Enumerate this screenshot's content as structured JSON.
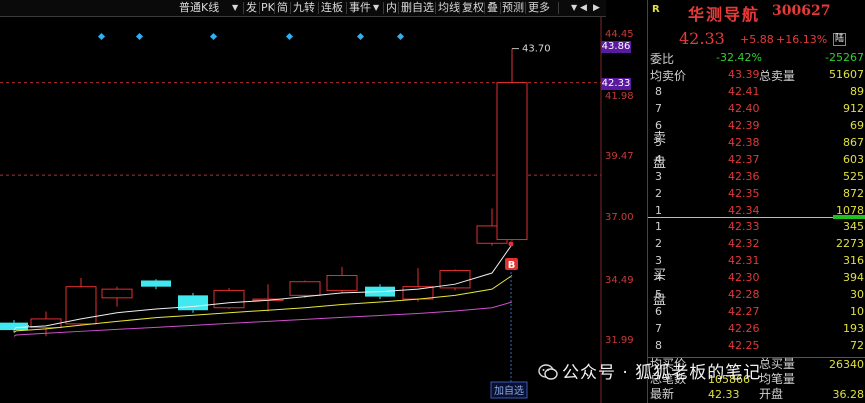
{
  "toolbar": {
    "items": [
      "普通K线",
      "发",
      "PK",
      "简",
      "九转",
      "连板",
      "事件",
      "内",
      "删自选",
      "均线",
      "复权",
      "叠",
      "预测",
      "更多"
    ],
    "dropdown": "▼",
    "back": "◀",
    "forward": "▶"
  },
  "chart": {
    "axis_labels": [
      "44.45",
      "41.98",
      "39.47",
      "37.00",
      "34.49",
      "31.99"
    ],
    "price_tags": [
      "43.86",
      "42.33"
    ],
    "high_label": "43.70",
    "buy_marker": "B",
    "add_button": "加自选"
  },
  "chart_data": {
    "type": "candlestick",
    "ylim": [
      31.99,
      44.45
    ],
    "up_color": "#e03030",
    "down_color": "#40e8f0",
    "candles": [
      {
        "o": 32.35,
        "c": 32.65,
        "h": 32.75,
        "l": 32.25,
        "dir": "down"
      },
      {
        "o": 32.55,
        "c": 32.5,
        "h": 32.6,
        "l": 32.45,
        "dir": "down"
      },
      {
        "o": 32.45,
        "c": 32.8,
        "h": 33.1,
        "l": 32.1,
        "dir": "up"
      },
      {
        "o": 32.6,
        "c": 34.1,
        "h": 34.45,
        "l": 32.55,
        "dir": "up"
      },
      {
        "o": 33.65,
        "c": 34.0,
        "h": 34.1,
        "l": 33.3,
        "dir": "up"
      },
      {
        "o": 34.35,
        "c": 34.1,
        "h": 34.4,
        "l": 34.0,
        "dir": "down"
      },
      {
        "o": 33.75,
        "c": 33.15,
        "h": 33.85,
        "l": 33.05,
        "dir": "down"
      },
      {
        "o": 33.25,
        "c": 33.95,
        "h": 34.05,
        "l": 33.2,
        "dir": "up"
      },
      {
        "o": 33.55,
        "c": 33.6,
        "h": 34.2,
        "l": 33.1,
        "dir": "up"
      },
      {
        "o": 33.75,
        "c": 34.3,
        "h": 34.35,
        "l": 33.65,
        "dir": "up"
      },
      {
        "o": 33.95,
        "c": 34.55,
        "h": 34.9,
        "l": 33.85,
        "dir": "up"
      },
      {
        "o": 34.1,
        "c": 33.7,
        "h": 34.2,
        "l": 33.6,
        "dir": "down"
      },
      {
        "o": 33.6,
        "c": 34.1,
        "h": 34.85,
        "l": 33.5,
        "dir": "up"
      },
      {
        "o": 34.05,
        "c": 34.75,
        "h": 34.8,
        "l": 33.95,
        "dir": "up"
      },
      {
        "o": 35.85,
        "c": 36.55,
        "h": 37.25,
        "l": 35.75,
        "dir": "up"
      },
      {
        "o": 36.0,
        "c": 42.33,
        "h": 43.7,
        "l": 35.95,
        "dir": "up"
      }
    ],
    "ma": [
      {
        "color": "#f0f0f0",
        "values": [
          32.35,
          32.45,
          32.52,
          32.8,
          33.05,
          33.2,
          33.3,
          33.45,
          33.55,
          33.7,
          33.85,
          33.9,
          34.0,
          34.2,
          34.65,
          35.8
        ]
      },
      {
        "color": "#e8e838",
        "values": [
          32.25,
          32.32,
          32.4,
          32.55,
          32.7,
          32.85,
          32.95,
          33.05,
          33.15,
          33.25,
          33.38,
          33.48,
          33.6,
          33.75,
          34.0,
          34.55
        ]
      },
      {
        "color": "#d050d0",
        "values": [
          32.1,
          32.15,
          32.22,
          32.3,
          32.38,
          32.46,
          32.54,
          32.62,
          32.7,
          32.78,
          32.86,
          32.94,
          33.02,
          33.12,
          33.25,
          33.48
        ]
      }
    ],
    "ref_lines": [
      42.33,
      38.6
    ]
  },
  "quote": {
    "logo": "R",
    "name": "华测导航",
    "code": "300627",
    "price": "42.33",
    "change": "+5.88",
    "pct": "+16.13%",
    "badge": "陆",
    "weibi_label": "委比",
    "weibi": "-32.42%",
    "weicha": "-25267",
    "avg_label": "均卖价",
    "avg": "43.39",
    "total_label": "总卖量",
    "total": "51607",
    "sell_label": [
      "卖",
      "盘"
    ],
    "buy_label": [
      "买",
      "盘"
    ],
    "sell": [
      {
        "lvl": "8",
        "price": "42.41",
        "vol": "89"
      },
      {
        "lvl": "7",
        "price": "42.40",
        "vol": "912"
      },
      {
        "lvl": "6",
        "price": "42.39",
        "vol": "69"
      },
      {
        "lvl": "5",
        "price": "42.38",
        "vol": "867"
      },
      {
        "lvl": "4",
        "price": "42.37",
        "vol": "603"
      },
      {
        "lvl": "3",
        "price": "42.36",
        "vol": "525"
      },
      {
        "lvl": "2",
        "price": "42.35",
        "vol": "872"
      },
      {
        "lvl": "1",
        "price": "42.34",
        "vol": "1078"
      }
    ],
    "buy": [
      {
        "lvl": "1",
        "price": "42.33",
        "vol": "345"
      },
      {
        "lvl": "2",
        "price": "42.32",
        "vol": "2273"
      },
      {
        "lvl": "3",
        "price": "42.31",
        "vol": "316"
      },
      {
        "lvl": "4",
        "price": "42.30",
        "vol": "394"
      },
      {
        "lvl": "5",
        "price": "42.28",
        "vol": "30"
      },
      {
        "lvl": "6",
        "price": "42.27",
        "vol": "10"
      },
      {
        "lvl": "7",
        "price": "42.26",
        "vol": "193"
      },
      {
        "lvl": "8",
        "price": "42.25",
        "vol": "72"
      }
    ],
    "bottom": [
      {
        "a": "均买价",
        "b": "",
        "c": "总买量",
        "d": "26340"
      },
      {
        "a": "总笔数",
        "b": "105866",
        "c": "均笔量",
        "d": ""
      },
      {
        "a": "最新",
        "b": "42.33",
        "c": "开盘",
        "d": "36.28"
      }
    ]
  },
  "watermark": "公众号 · 狐狐老板的笔记"
}
